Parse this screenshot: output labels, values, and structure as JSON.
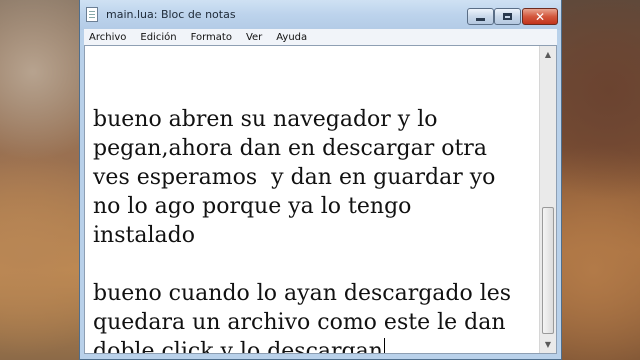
{
  "window": {
    "title": "main.lua: Bloc de notas",
    "controls": {
      "minimize_icon": "minimize-icon",
      "maximize_icon": "maximize-icon",
      "close_icon": "close-icon",
      "close_glyph": "✕"
    }
  },
  "menu": {
    "items": [
      "Archivo",
      "Edición",
      "Formato",
      "Ver",
      "Ayuda"
    ]
  },
  "editor": {
    "lines": [
      "",
      "bueno abren su navegador y lo",
      "pegan,ahora dan en descargar otra",
      "ves esperamos  y dan en guardar yo",
      "no lo ago porque ya lo tengo",
      "instalado",
      "",
      "bueno cuando lo ayan descargado les",
      "quedara un archivo como este le dan",
      "doble click y lo descargan"
    ]
  },
  "scrollbar": {
    "up_glyph": "▲",
    "down_glyph": "▼"
  },
  "colors": {
    "titlebar": "#bcd3ec",
    "close_button": "#c2341d",
    "editor_bg": "#ffffff"
  }
}
